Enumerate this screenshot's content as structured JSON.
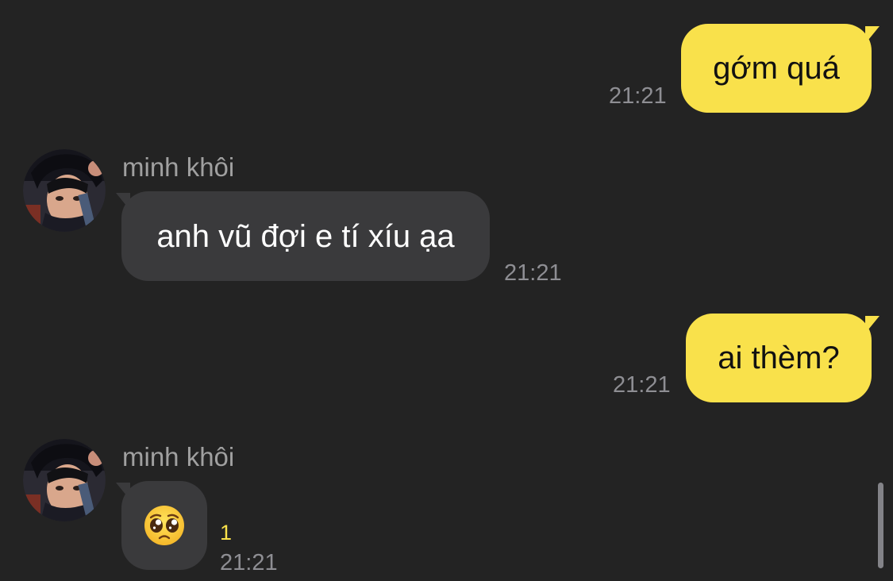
{
  "conversation": {
    "messages": [
      {
        "direction": "out",
        "text": "gớm quá",
        "time": "21:21"
      },
      {
        "direction": "in",
        "sender": "minh khôi",
        "text": "anh vũ đợi e tí xíu ạa",
        "time": "21:21"
      },
      {
        "direction": "out",
        "text": "ai thèm?",
        "time": "21:21"
      },
      {
        "direction": "in",
        "sender": "minh khôi",
        "emoji": "pleading-face",
        "unread_count": "1",
        "time": "21:21"
      }
    ]
  },
  "colors": {
    "background": "#232323",
    "outgoing_bubble": "#f9e14b",
    "incoming_bubble": "#3a3a3c",
    "timestamp": "#8e8e93",
    "unread": "#f9e14b"
  }
}
